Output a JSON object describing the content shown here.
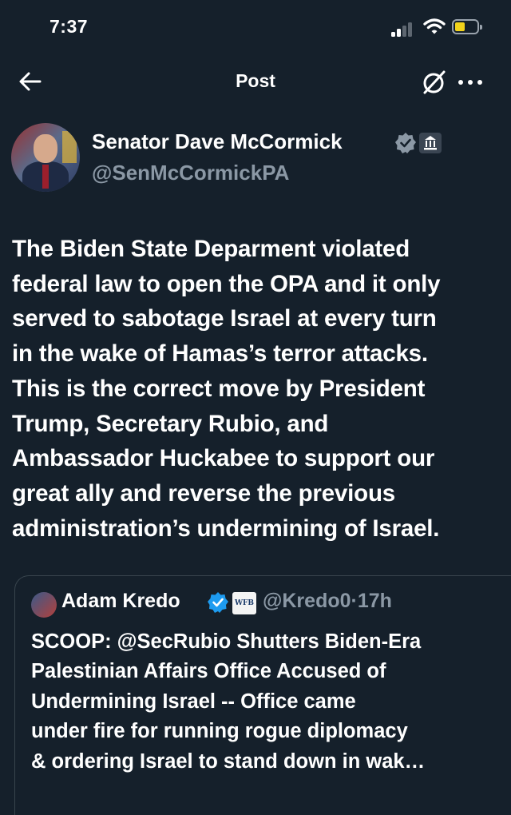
{
  "status_bar": {
    "time": "7:37"
  },
  "header": {
    "title": "Post"
  },
  "post": {
    "author_name": "Senator Dave McCormick",
    "author_handle": "@SenMcCormickPA",
    "text_lines": [
      "The Biden State Deparment violated",
      "federal law to open the OPA and it only",
      "served to sabotage Israel at every turn",
      "in the wake of Hamas’s terror attacks.",
      "This is the correct move by President",
      "Trump, Secretary Rubio, and",
      "Ambassador Huckabee to support our",
      "great ally and reverse the previous",
      "administration’s undermining of Israel."
    ]
  },
  "quote": {
    "author_name": "Adam Kredo",
    "badge_text": "WFB",
    "author_handle": "@Kredo0",
    "separator": "·",
    "time": "17h",
    "text_lines": [
      "SCOOP: @SecRubio Shutters Biden-Era",
      "Palestinian Affairs Office Accused of",
      "Undermining Israel -- Office came",
      "under fire for running rogue diplomacy",
      "& ordering Israel to stand down in wak…"
    ]
  },
  "colors": {
    "background": "#15202b",
    "text": "#ffffff",
    "secondary_text": "#8b98a5",
    "verified_badge": "#1d9bf0",
    "battery": "#f2d31b"
  }
}
